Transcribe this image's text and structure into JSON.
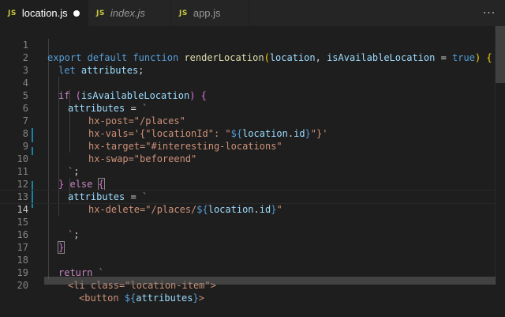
{
  "tabs": [
    {
      "icon": "JS",
      "label": "location.js",
      "active": true,
      "modified": true
    },
    {
      "icon": "JS",
      "label": "index.js",
      "active": false,
      "italic": true
    },
    {
      "icon": "JS",
      "label": "app.js",
      "active": false
    }
  ],
  "tabbar_more": "···",
  "colors": {
    "background": "#1e1e1e",
    "tab_bar": "#252526",
    "keyword": "#c586c0",
    "storage": "#569cd6",
    "function": "#dcdcaa",
    "variable": "#9cdcfe",
    "string": "#ce9178",
    "line_number": "#858585",
    "modified_gutter": "#1b81a8",
    "js_icon": "#cbcb41"
  },
  "editor": {
    "current_line": 14,
    "lines": [
      {
        "n": "1"
      },
      {
        "n": "2"
      },
      {
        "n": "3"
      },
      {
        "n": "4"
      },
      {
        "n": "5"
      },
      {
        "n": "6"
      },
      {
        "n": "7"
      },
      {
        "n": "8"
      },
      {
        "n": "9"
      },
      {
        "n": "10"
      },
      {
        "n": "11"
      },
      {
        "n": "12"
      },
      {
        "n": "13"
      },
      {
        "n": "14"
      },
      {
        "n": "15"
      },
      {
        "n": "16"
      },
      {
        "n": "17"
      },
      {
        "n": "18"
      },
      {
        "n": "19"
      },
      {
        "n": "20"
      }
    ]
  },
  "code": {
    "l1": {
      "export": "export",
      "default": "default",
      "function": "function",
      "name": "renderLocation",
      "open": "(",
      "p1": "location",
      "comma": ", ",
      "p2": "isAvailableLocation",
      "eq": " = ",
      "true": "true",
      "close": ")",
      "brace": " {"
    },
    "l2": {
      "let": "let",
      "var": "attributes",
      "semi": ";"
    },
    "l4": {
      "if": "if",
      "open": " (",
      "var": "isAvailableLocation",
      "close": ")",
      "brace": " {"
    },
    "l5": {
      "var": "attributes",
      "eq": " = ",
      "tick": "`"
    },
    "l6": {
      "text": "hx-post=\"/places\""
    },
    "l7": {
      "pre": "hx-vals='{\"locationId\": \"",
      "ip_open": "${",
      "expr_obj": "location",
      "dot": ".",
      "expr_prop": "id",
      "ip_close": "}",
      "post": "\"}'"
    },
    "l8": {
      "text": "hx-target=\"#interesting-locations\""
    },
    "l9": {
      "text": "hx-swap=\"beforeend\""
    },
    "l10": {
      "tick": "`",
      "semi": ";"
    },
    "l11": {
      "close": "}",
      "else": "else",
      "brace": "{"
    },
    "l12": {
      "var": "attributes",
      "eq": " = ",
      "tick": "`"
    },
    "l13": {
      "pre": "hx-delete=\"/places/",
      "ip_open": "${",
      "expr_obj": "location",
      "dot": ".",
      "expr_prop": "id",
      "ip_close": "}",
      "post": "\""
    },
    "l15": {
      "tick": "`",
      "semi": ";"
    },
    "l16": {
      "close": "}"
    },
    "l18": {
      "return": "return",
      "tick": " `"
    },
    "l19": {
      "text": "<li class=\"location-item\">"
    },
    "l20": {
      "pre": "<button ",
      "ip_open": "${",
      "var": "attributes",
      "ip_close": "}",
      "post": ">"
    }
  }
}
